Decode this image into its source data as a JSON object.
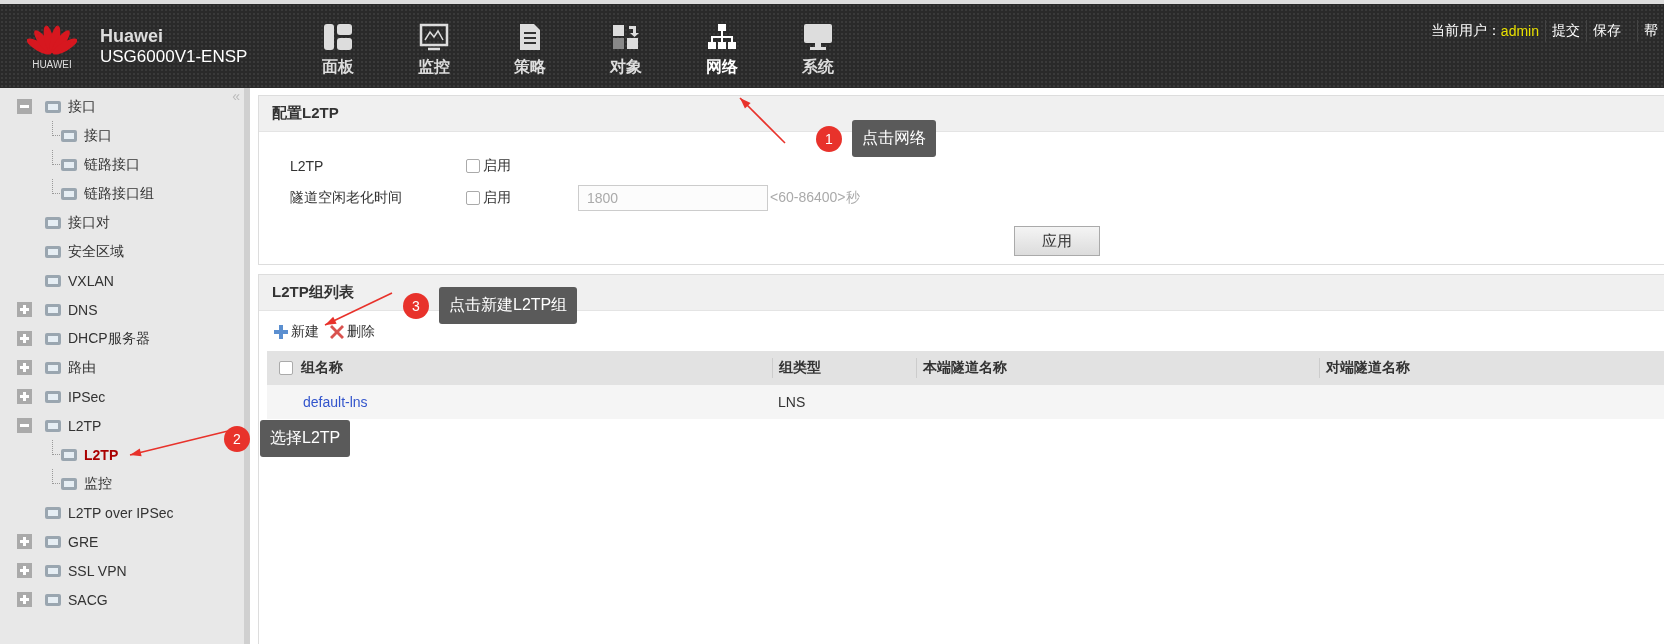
{
  "header": {
    "logo_text": "HUAWEI",
    "brand": "Huawei",
    "model": "USG6000V1-ENSP",
    "nav": [
      {
        "label": "面板",
        "selected": false
      },
      {
        "label": "监控",
        "selected": false
      },
      {
        "label": "策略",
        "selected": false
      },
      {
        "label": "对象",
        "selected": false
      },
      {
        "label": "网络",
        "selected": true
      },
      {
        "label": "系统",
        "selected": false
      }
    ],
    "user_label": "当前用户：",
    "user": "admin",
    "actions": [
      "提交",
      "保存",
      "帮"
    ]
  },
  "sidebar": {
    "collapse_glyph": "«",
    "items": [
      {
        "label": "接口",
        "expanded": true,
        "children": [
          {
            "label": "接口",
            "selected": false
          },
          {
            "label": "链路接口",
            "selected": false
          },
          {
            "label": "链路接口组",
            "selected": false
          }
        ]
      },
      {
        "label": "接口对"
      },
      {
        "label": "安全区域"
      },
      {
        "label": "VXLAN"
      },
      {
        "label": "DNS",
        "expanded": false
      },
      {
        "label": "DHCP服务器",
        "expanded": false
      },
      {
        "label": "路由",
        "expanded": false
      },
      {
        "label": "IPSec",
        "expanded": false
      },
      {
        "label": "L2TP",
        "expanded": true,
        "children": [
          {
            "label": "L2TP",
            "selected": true
          },
          {
            "label": "监控",
            "selected": false
          }
        ]
      },
      {
        "label": "L2TP over IPSec"
      },
      {
        "label": "GRE",
        "expanded": false
      },
      {
        "label": "SSL VPN",
        "expanded": false
      },
      {
        "label": "SACG",
        "expanded": false
      }
    ]
  },
  "config_panel": {
    "title": "配置L2TP",
    "rows": [
      {
        "label": "L2TP",
        "checkbox": {
          "label": "启用",
          "checked": false
        }
      },
      {
        "label": "隧道空闲老化时间",
        "checkbox": {
          "label": "启用",
          "checked": false
        },
        "input": {
          "value": "1800",
          "disabled": true
        },
        "hint": "<60-86400>秒"
      }
    ],
    "apply_button": "应用"
  },
  "group_list": {
    "title": "L2TP组列表",
    "toolbar": [
      {
        "kind": "add",
        "label": "新建"
      },
      {
        "kind": "delete",
        "label": "删除"
      }
    ],
    "table": {
      "select_all_checked": false,
      "columns": [
        "组名称",
        "组类型",
        "本端隧道名称",
        "对端隧道名称"
      ],
      "rows": [
        {
          "name": "default-lns",
          "type": "LNS"
        }
      ]
    }
  },
  "annotations": [
    {
      "number": "1",
      "text": "点击网络"
    },
    {
      "number": "2",
      "text": "选择L2TP"
    },
    {
      "number": "3",
      "text": "点击新建L2TP组"
    }
  ]
}
